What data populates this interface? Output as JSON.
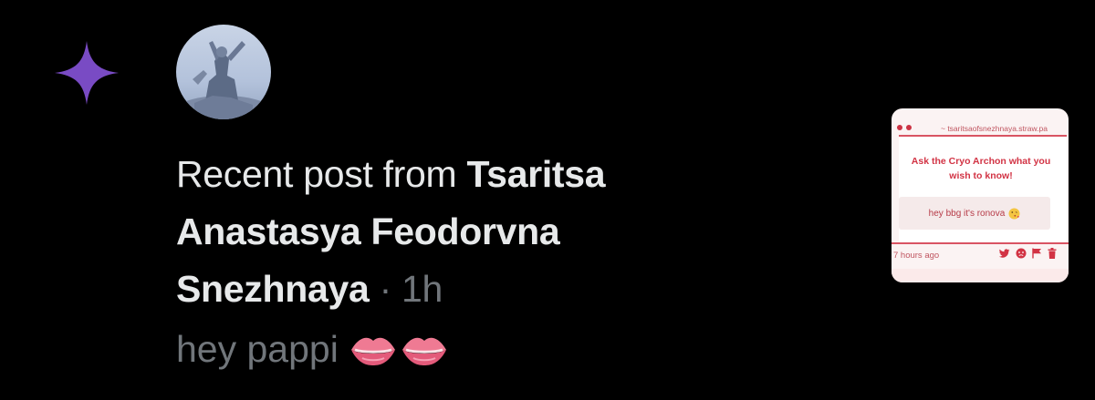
{
  "notification": {
    "headline_prefix": "Recent post from",
    "author_name": "Tsaritsa Anastasya Feodorvna Snezhnaya",
    "separator": "·",
    "time_ago": "1h",
    "post_text": "hey pappi",
    "emoji": [
      "lips-icon",
      "lips-icon"
    ]
  },
  "thumbnail": {
    "url": "~ tsaritsaofsnezhnaya.straw.pa",
    "question": "Ask the Cryo Archon what you wish to know!",
    "answer": "hey bbg it's ronova",
    "time": "7 hours ago",
    "actions": [
      "twitter-icon",
      "face-icon",
      "flag-icon",
      "trash-icon"
    ]
  },
  "colors": {
    "background": "#000000",
    "primary_text": "#e7e9ea",
    "secondary_text": "#71767b",
    "sparkle": "#794bc4",
    "thumb_accent": "#d23344"
  }
}
